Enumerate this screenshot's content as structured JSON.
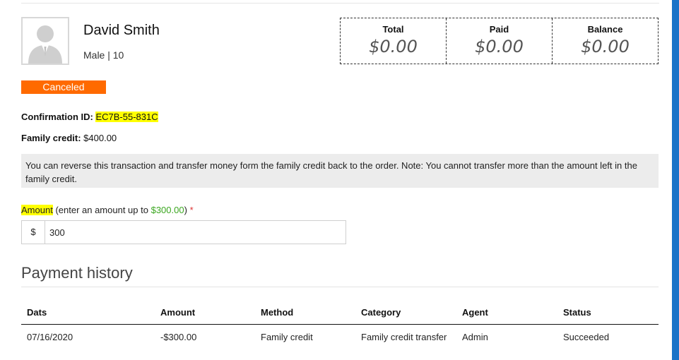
{
  "patient": {
    "name": "David Smith",
    "details": "Male | 10"
  },
  "totals": {
    "total_label": "Total",
    "total_value": "$0.00",
    "paid_label": "Paid",
    "paid_value": "$0.00",
    "balance_label": "Balance",
    "balance_value": "$0.00"
  },
  "status": {
    "label": "Canceled",
    "color": "#ff6a00"
  },
  "confirmation": {
    "label": "Confirmation ID:",
    "value": "EC7B-55-831C"
  },
  "family_credit": {
    "label": "Family credit:",
    "value": "$400.00"
  },
  "note": "You can reverse this transaction and transfer money form the family credit back to the order. Note: You cannot transfer more than the amount left in the family credit.",
  "amount": {
    "label": "Amount",
    "hint_prefix": "(enter an amount up to",
    "hint_value": "$300.00",
    "hint_suffix": ")",
    "required_mark": "*",
    "currency": "$",
    "value": "300"
  },
  "history": {
    "title": "Payment history",
    "columns": [
      "Dats",
      "Amount",
      "Method",
      "Category",
      "Agent",
      "Status"
    ],
    "rows": [
      [
        "07/16/2020",
        "-$300.00",
        "Family credit",
        "Family credit transfer",
        "Admin",
        "Succeeded"
      ]
    ]
  }
}
